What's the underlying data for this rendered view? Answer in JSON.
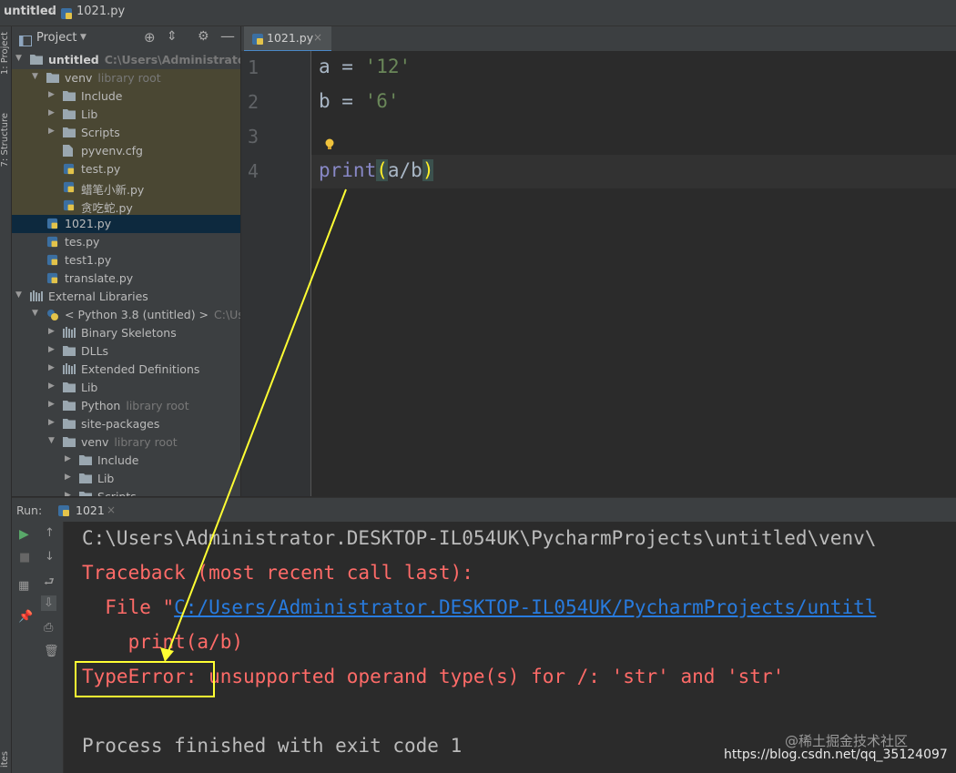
{
  "breadcrumb": {
    "project": "untitled",
    "file": "1021.py"
  },
  "sidestrip": {
    "project_label": "1: Project",
    "structure_label": "7: Structure",
    "bottom_label": "ites"
  },
  "project_panel": {
    "title": "Project",
    "tree": [
      {
        "label": "untitled",
        "hint": "C:\\Users\\Administrator.DESK",
        "type": "folder",
        "open": true
      },
      {
        "label": "venv",
        "hint": "library root",
        "type": "folder",
        "open": true
      },
      {
        "label": "Include",
        "hint": "",
        "type": "folder",
        "open": false
      },
      {
        "label": "Lib",
        "hint": "",
        "type": "folder",
        "open": false
      },
      {
        "label": "Scripts",
        "hint": "",
        "type": "folder",
        "open": false
      },
      {
        "label": "pyvenv.cfg",
        "hint": "",
        "type": "file"
      },
      {
        "label": "test.py",
        "hint": "",
        "type": "py"
      },
      {
        "label": "蜡笔小新.py",
        "hint": "",
        "type": "py"
      },
      {
        "label": "贪吃蛇.py",
        "hint": "",
        "type": "py"
      },
      {
        "label": "1021.py",
        "hint": "",
        "type": "py",
        "selected": true
      },
      {
        "label": "tes.py",
        "hint": "",
        "type": "py"
      },
      {
        "label": "test1.py",
        "hint": "",
        "type": "py"
      },
      {
        "label": "translate.py",
        "hint": "",
        "type": "py"
      },
      {
        "label": "External Libraries",
        "hint": "",
        "type": "lib",
        "open": true
      },
      {
        "label": "< Python 3.8 (untitled) >",
        "hint": "C:\\Users",
        "type": "python",
        "open": true
      },
      {
        "label": "Binary Skeletons",
        "hint": "",
        "type": "lib",
        "open": false
      },
      {
        "label": "DLLs",
        "hint": "",
        "type": "folder",
        "open": false
      },
      {
        "label": "Extended Definitions",
        "hint": "",
        "type": "lib",
        "open": false
      },
      {
        "label": "Lib",
        "hint": "",
        "type": "folder",
        "open": false
      },
      {
        "label": "Python",
        "hint": "library root",
        "type": "folder",
        "open": false
      },
      {
        "label": "site-packages",
        "hint": "",
        "type": "folder",
        "open": false
      },
      {
        "label": "venv",
        "hint": "library root",
        "type": "folder",
        "open": true
      },
      {
        "label": "Include",
        "hint": "",
        "type": "folder",
        "open": false
      },
      {
        "label": "Lib",
        "hint": "",
        "type": "folder",
        "open": false
      },
      {
        "label": "Scripts",
        "hint": "",
        "type": "folder",
        "open": false
      }
    ]
  },
  "editor": {
    "tab_label": "1021.py",
    "line_numbers": [
      "1",
      "2",
      "3",
      "4"
    ],
    "lines": {
      "l1_var": "a = ",
      "l1_str": "'12'",
      "l2_var": "b = ",
      "l2_str": "'6'",
      "l4_fn": "print",
      "l4_open": "(",
      "l4_args": "a/b",
      "l4_close": ")"
    }
  },
  "run": {
    "label": "Run:",
    "config": "1021",
    "output": {
      "path_line": "C:\\Users\\Administrator.DESKTOP-IL054UK\\PycharmProjects\\untitled\\venv\\",
      "traceback": "Traceback (most recent call last):",
      "file_prefix": "  File \"",
      "file_link": "C:/Users/Administrator.DESKTOP-IL054UK/PycharmProjects/untitl",
      "code_line": "    print(a/b)",
      "error_type": "TypeError:",
      "error_msg": " unsupported operand type(s) for /: 'str' and 'str'",
      "finished": "Process finished with exit code 1"
    }
  },
  "watermark": {
    "line1": "@稀土掘金技术社区",
    "line2": "https://blog.csdn.net/qq_35124097"
  },
  "colors": {
    "annotation": "#ffff33",
    "error": "#ff6b68",
    "link": "#287bde"
  }
}
